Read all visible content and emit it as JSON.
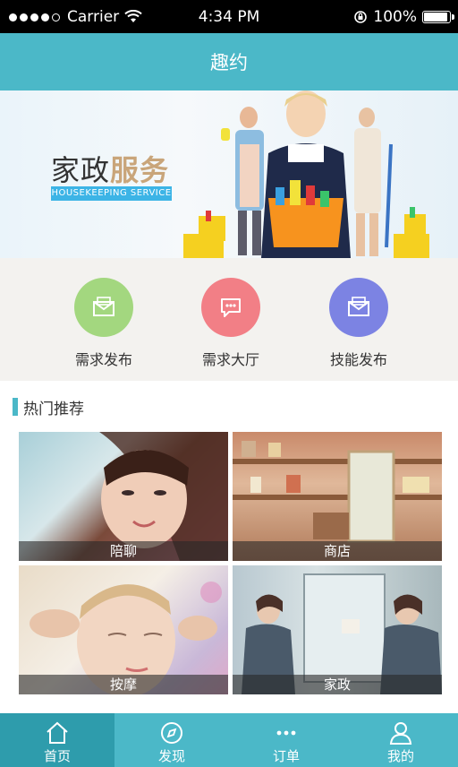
{
  "status_bar": {
    "carrier": "Carrier",
    "time": "4:34 PM",
    "battery": "100%",
    "battery_level": 1.0
  },
  "header": {
    "title": "趣约"
  },
  "banner": {
    "title_main": "家政",
    "title_accent": "服务",
    "subtitle": "HOUSEKEEPING SERVICE"
  },
  "shortcuts": [
    {
      "label": "需求发布",
      "icon": "envelope-icon",
      "color": "#a3d77f"
    },
    {
      "label": "需求大厅",
      "icon": "chat-bubble-icon",
      "color": "#f27f86"
    },
    {
      "label": "技能发布",
      "icon": "envelope-icon",
      "color": "#7c83e3"
    }
  ],
  "hot": {
    "title": "热门推荐",
    "items": [
      {
        "label": "陪聊"
      },
      {
        "label": "商店"
      },
      {
        "label": "按摩"
      },
      {
        "label": "家政"
      }
    ]
  },
  "tabbar": {
    "items": [
      {
        "label": "首页",
        "icon": "home-icon",
        "active": true
      },
      {
        "label": "发现",
        "icon": "compass-icon",
        "active": false
      },
      {
        "label": "订单",
        "icon": "more-dots-icon",
        "active": false
      },
      {
        "label": "我的",
        "icon": "user-icon",
        "active": false
      }
    ]
  },
  "colors": {
    "accent": "#4bb8c8",
    "accent_dark": "#2e9cac"
  }
}
